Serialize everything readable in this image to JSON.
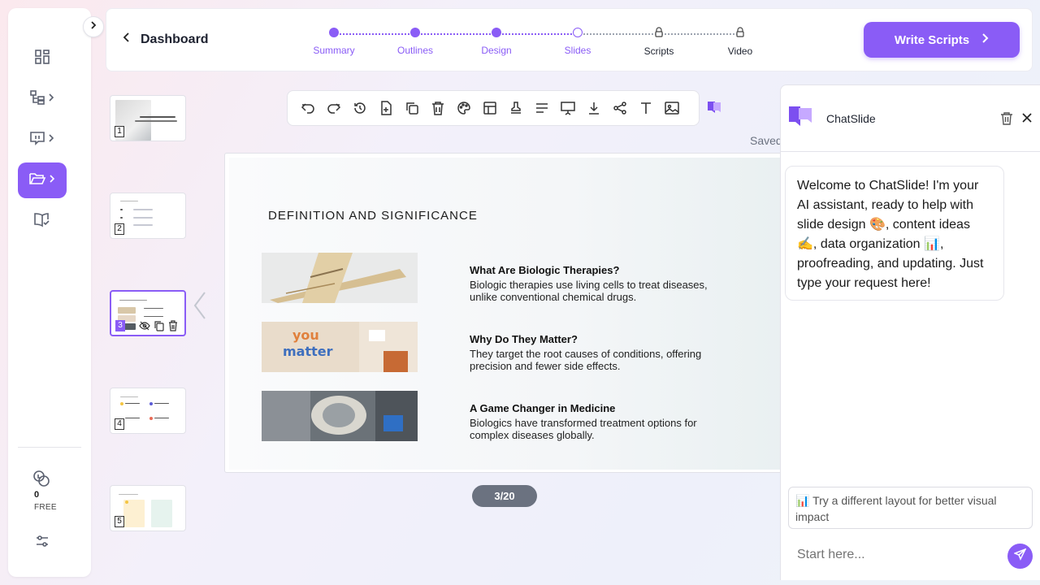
{
  "rail": {
    "credits": "0",
    "plan": "FREE"
  },
  "header": {
    "back_label": "Dashboard",
    "steps": [
      {
        "label": "Summary",
        "state": "done"
      },
      {
        "label": "Outlines",
        "state": "done"
      },
      {
        "label": "Design",
        "state": "done"
      },
      {
        "label": "Slides",
        "state": "current"
      },
      {
        "label": "Scripts",
        "state": "locked"
      },
      {
        "label": "Video",
        "state": "locked"
      }
    ],
    "primary_button": "Write Scripts"
  },
  "thumbnails": [
    {
      "num": "1"
    },
    {
      "num": "2"
    },
    {
      "num": "3"
    },
    {
      "num": "4"
    },
    {
      "num": "5"
    }
  ],
  "toolbar": {
    "tools": [
      "undo-icon",
      "redo-icon",
      "history-icon",
      "add-page-icon",
      "duplicate-icon",
      "delete-icon",
      "palette-icon",
      "layout-icon",
      "stamp-icon",
      "align-icon",
      "present-icon",
      "download-icon",
      "share-icon",
      "text-icon",
      "image-icon"
    ],
    "saved_status": "Saved"
  },
  "slide": {
    "title": "DEFINITION AND SIGNIFICANCE",
    "items": [
      {
        "heading": "What Are Biologic Therapies?",
        "text": "Biologic therapies use living cells to treat diseases, unlike conventional chemical drugs."
      },
      {
        "heading": "Why Do They Matter?",
        "text": "They target the root causes of conditions, offering precision and fewer side effects."
      },
      {
        "heading": "A Game Changer in Medicine",
        "text": "Biologics have transformed treatment options for complex diseases globally."
      }
    ],
    "page_indicator": "3/20"
  },
  "chat": {
    "title": "ChatSlide",
    "welcome": "Welcome to ChatSlide! I'm your AI assistant, ready to help with slide design 🎨, content ideas ✍️, data organization 📊, proofreading, and updating. Just type your request here!",
    "suggestion": "📊 Try a different layout for better visual impact",
    "input_placeholder": "Start here..."
  },
  "colors": {
    "accent": "#8a5cf6",
    "pill": "#6b7280"
  }
}
